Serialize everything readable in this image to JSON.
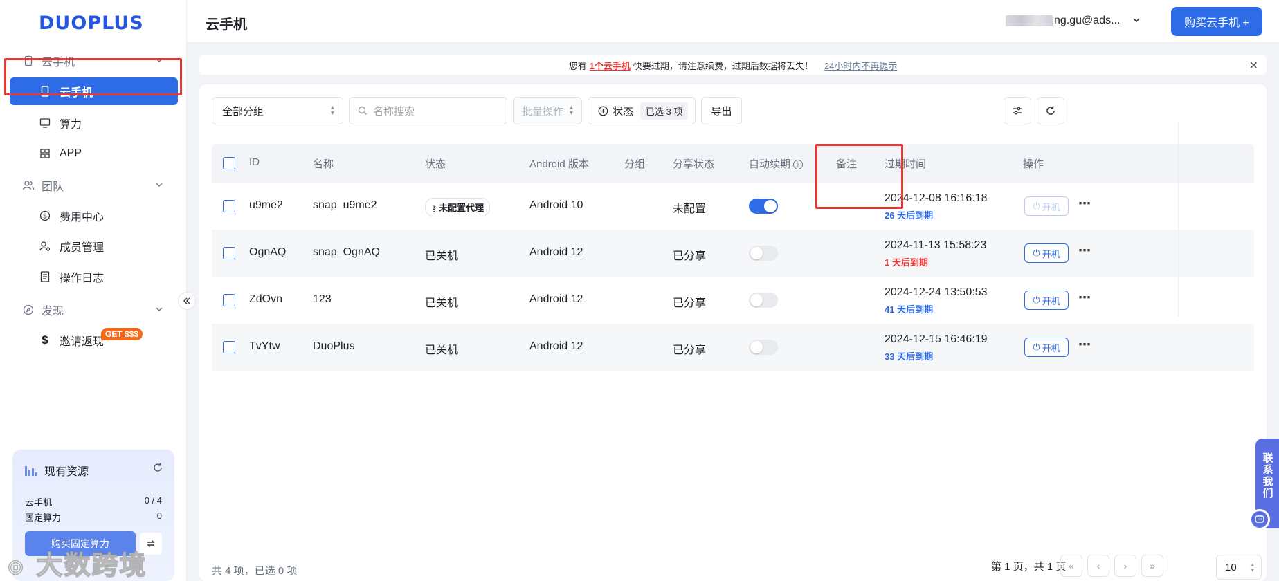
{
  "brand": {
    "logo_text": "DUOPLUS"
  },
  "sidebar": {
    "groups": [
      {
        "label": "云手机"
      },
      {
        "label": "团队"
      },
      {
        "label": "发现"
      }
    ],
    "items": [
      {
        "label": "云手机"
      },
      {
        "label": "算力"
      },
      {
        "label": "APP"
      },
      {
        "label": "费用中心"
      },
      {
        "label": "成员管理"
      },
      {
        "label": "操作日志"
      },
      {
        "label": "邀请返现"
      }
    ],
    "invite_badge": "GET $$$",
    "resources": {
      "title": "现有资源",
      "rows": [
        {
          "label": "云手机",
          "value": "0 / 4"
        },
        {
          "label": "固定算力",
          "value": "0"
        }
      ],
      "buy_label": "购买固定算力"
    }
  },
  "header": {
    "title": "云手机",
    "user_email": "ng.gu@ads...",
    "buy_button": "购买云手机 +"
  },
  "notice": {
    "prefix": "您有",
    "highlight": "1个云手机",
    "suffix": "快要过期，请注意续费，过期后数据将丢失！",
    "dismiss": "24小时内不再提示"
  },
  "toolbar": {
    "group_select": "全部分组",
    "search_placeholder": "名称搜索",
    "batch_label": "批量操作",
    "status_label": "状态",
    "status_chip": "已选 3 项",
    "export_label": "导出"
  },
  "table": {
    "columns": [
      "ID",
      "名称",
      "状态",
      "Android 版本",
      "分组",
      "分享状态",
      "自动续期",
      "备注",
      "过期时间",
      "操作"
    ],
    "rows": [
      {
        "id": "u9me2",
        "name": "snap_u9me2",
        "status": "未配置代理",
        "android": "Android 10",
        "group": "",
        "share": "未配置",
        "auto_renew": true,
        "note": "",
        "expire_date": "2024-12-08 16:16:18",
        "expire_days": "26 天后到期",
        "power": "开机"
      },
      {
        "id": "OgnAQ",
        "name": "snap_OgnAQ",
        "status": "已关机",
        "android": "Android 12",
        "group": "",
        "share": "已分享",
        "auto_renew": false,
        "note": "",
        "expire_date": "2024-11-13 15:58:23",
        "expire_days": "1 天后到期",
        "power": "开机"
      },
      {
        "id": "ZdOvn",
        "name": "123",
        "status": "已关机",
        "android": "Android 12",
        "group": "",
        "share": "已分享",
        "auto_renew": false,
        "note": "",
        "expire_date": "2024-12-24 13:50:53",
        "expire_days": "41 天后到期",
        "power": "开机"
      },
      {
        "id": "TvYtw",
        "name": "DuoPlus",
        "status": "已关机",
        "android": "Android 12",
        "group": "",
        "share": "已分享",
        "auto_renew": false,
        "note": "",
        "expire_date": "2024-12-15 16:46:19",
        "expire_days": "33 天后到期",
        "power": "开机"
      }
    ]
  },
  "footer": {
    "count_text": "共 4 项，已选 0 项",
    "page_text": "第 1 页，共 1 页",
    "page_size": "10"
  },
  "contact": {
    "label": "联系我们"
  },
  "watermark": "大数跨境",
  "colors": {
    "primary": "#2e6be6",
    "danger": "#e53935",
    "highlight": "#e53935"
  }
}
